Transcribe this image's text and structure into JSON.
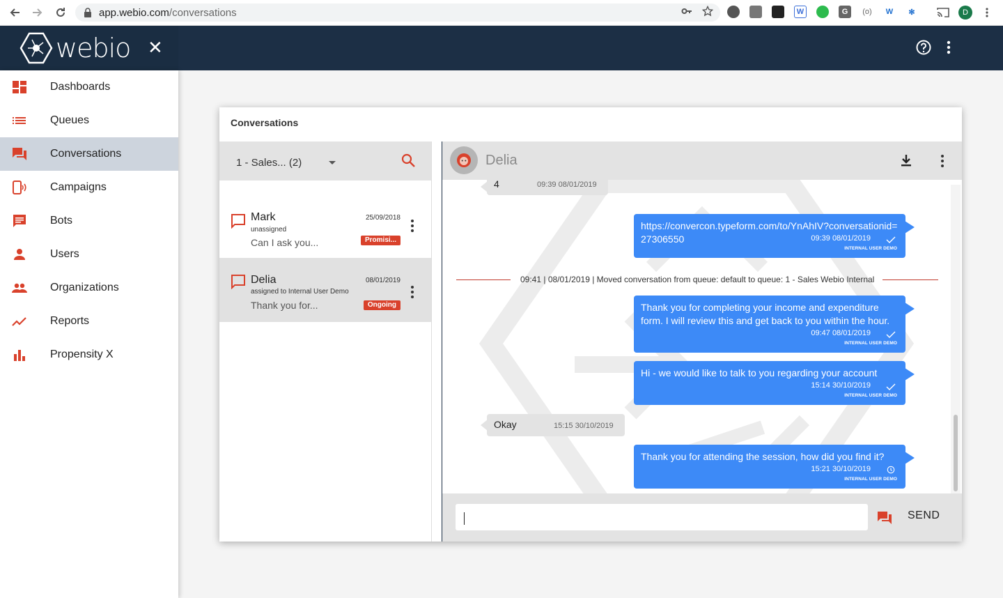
{
  "browser": {
    "url_host": "app.webio.com",
    "url_path": "/conversations",
    "profile_initial": "D"
  },
  "app": {
    "logo": "webio",
    "close_label": "✕",
    "brand_color": "#d9412b",
    "header_color": "#1c2f45"
  },
  "sidebar": {
    "items": [
      {
        "label": "Dashboards",
        "icon": "dashboard-icon"
      },
      {
        "label": "Queues",
        "icon": "list-icon"
      },
      {
        "label": "Conversations",
        "icon": "forum-icon",
        "active": true
      },
      {
        "label": "Campaigns",
        "icon": "campaign-phone-icon"
      },
      {
        "label": "Bots",
        "icon": "chat-bubble-icon"
      },
      {
        "label": "Users",
        "icon": "person-icon"
      },
      {
        "label": "Organizations",
        "icon": "people-icon"
      },
      {
        "label": "Reports",
        "icon": "trending-icon"
      },
      {
        "label": "Propensity X",
        "icon": "bar-chart-icon"
      }
    ]
  },
  "panel": {
    "title": "Conversations"
  },
  "list": {
    "queue": "1 - Sales... (2)",
    "conversations": [
      {
        "name": "Mark",
        "sub": "unassigned",
        "preview": "Can I ask you...",
        "date": "25/09/2018",
        "badge": "Promisi..."
      },
      {
        "name": "Delia",
        "sub": "assigned to Internal User Demo",
        "preview": "Thank you for...",
        "date": "08/01/2019",
        "badge": "Ongoing"
      }
    ]
  },
  "chat": {
    "contact": "Delia",
    "messages": [
      {
        "dir": "in",
        "text": "4",
        "time": "09:39 08/01/2019"
      },
      {
        "dir": "out",
        "text": "https://convercon.typeform.com/to/YnAhIV?conversationid=27306550",
        "time": "09:39 08/01/2019",
        "by": "INTERNAL USER DEMO",
        "status": "check-icon"
      },
      {
        "dir": "system",
        "text": "09:41 | 08/01/2019 | Moved conversation from queue: default to queue: 1 - Sales Webio Internal"
      },
      {
        "dir": "out",
        "text": "Thank you for completing your income and expenditure form. I will review this and get back to you within the hour.",
        "time": "09:47 08/01/2019",
        "by": "INTERNAL USER DEMO",
        "status": "check-icon"
      },
      {
        "dir": "out",
        "text": "Hi - we would like to talk to you regarding your account",
        "time": "15:14 30/10/2019",
        "by": "INTERNAL USER DEMO",
        "status": "check-icon"
      },
      {
        "dir": "in",
        "text": "Okay",
        "time": "15:15 30/10/2019"
      },
      {
        "dir": "out",
        "text": "Thank you for attending the session, how did you find it?",
        "time": "15:21 30/10/2019",
        "by": "INTERNAL USER DEMO",
        "status": "clock-icon"
      }
    ],
    "composer": {
      "value": "",
      "send_label": "SEND"
    }
  }
}
